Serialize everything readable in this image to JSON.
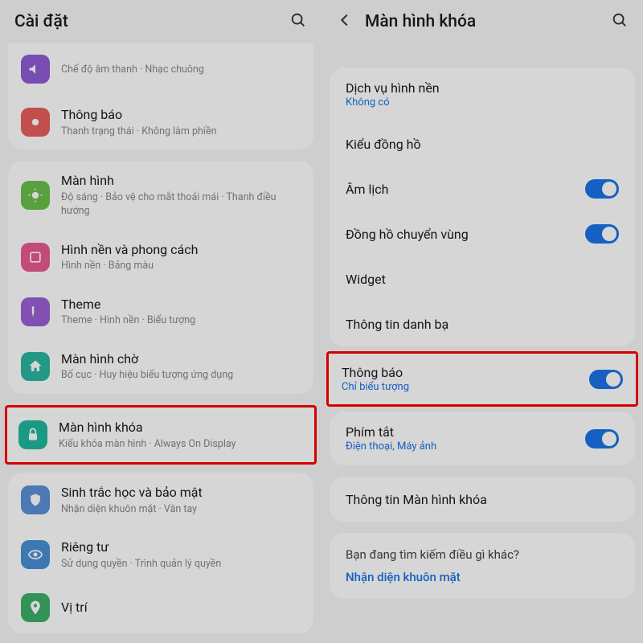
{
  "left": {
    "title": "Cài đặt",
    "items": {
      "sound": {
        "title": "",
        "sub": "Chế độ âm thanh  ·  Nhạc chuông"
      },
      "notifications": {
        "title": "Thông báo",
        "sub": "Thanh trạng thái  ·  Không làm phiền"
      },
      "display": {
        "title": "Màn hình",
        "sub": "Độ sáng  ·  Bảo vệ cho mắt thoải mái  ·  Thanh điều hướng"
      },
      "wallpaper": {
        "title": "Hình nền và phong cách",
        "sub": "Hình nền  ·  Bảng màu"
      },
      "theme": {
        "title": "Theme",
        "sub": "Theme  ·  Hình nền  ·  Biểu tượng"
      },
      "home": {
        "title": "Màn hình chờ",
        "sub": "Bố cục  ·  Huy hiệu biểu tượng ứng dụng"
      },
      "lock": {
        "title": "Màn hình khóa",
        "sub": "Kiểu khóa màn hình  ·  Always On Display"
      },
      "biometrics": {
        "title": "Sinh trắc học và bảo mật",
        "sub": "Nhận diện khuôn mặt  ·  Vân tay"
      },
      "privacy": {
        "title": "Riêng tư",
        "sub": "Sử dụng quyền  ·  Trình quản lý quyền"
      },
      "location": {
        "title": "Vị trí",
        "sub": ""
      }
    }
  },
  "right": {
    "title": "Màn hình khóa",
    "items": {
      "wallpaper_service": {
        "title": "Dịch vụ hình nền",
        "sub": "Không có"
      },
      "clock_style": {
        "title": "Kiểu đồng hồ"
      },
      "lunar": {
        "title": "Âm lịch"
      },
      "roaming": {
        "title": "Đồng hồ chuyển vùng"
      },
      "widget": {
        "title": "Widget"
      },
      "contact": {
        "title": "Thông tin danh bạ"
      },
      "notifications": {
        "title": "Thông báo",
        "sub": "Chỉ biểu tượng"
      },
      "shortcuts": {
        "title": "Phím tắt",
        "sub": "Điện thoại, Máy ảnh"
      },
      "about": {
        "title": "Thông tin Màn hình khóa"
      }
    },
    "footer": {
      "question": "Bạn đang tìm kiếm điều gì khác?",
      "link": "Nhận diện khuôn mặt"
    }
  }
}
